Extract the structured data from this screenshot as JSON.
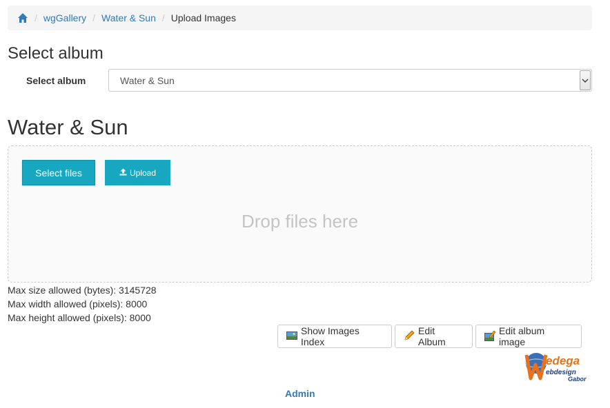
{
  "breadcrumb": {
    "home_icon": "home-icon",
    "items": [
      "wgGallery",
      "Water & Sun"
    ],
    "separator": "/",
    "active": "Upload Images"
  },
  "select_album_section": {
    "heading": "Select album",
    "label": "Select album",
    "selected_value": "Water & Sun"
  },
  "album": {
    "title": "Water & Sun"
  },
  "uploader": {
    "select_files_label": "Select files",
    "upload_label": "Upload",
    "drop_text": "Drop files here"
  },
  "limits": {
    "max_size": "Max size allowed (bytes): 3145728",
    "max_width": "Max width allowed (pixels): 8000",
    "max_height": "Max height allowed (pixels): 8000"
  },
  "actions": {
    "show_index_label": "Show Images Index",
    "edit_album_label": "Edit Album",
    "edit_album_image_label": "Edit album image"
  },
  "logo": {
    "brand": "edega",
    "line1": "ebdesign",
    "line2": "Gabor"
  },
  "footer": {
    "admin_label": "Admin"
  },
  "colors": {
    "link": "#337ab7",
    "primary_button": "#17a7c0",
    "breadcrumb_bg": "#f5f5f5",
    "logo_orange": "#e8721c"
  }
}
